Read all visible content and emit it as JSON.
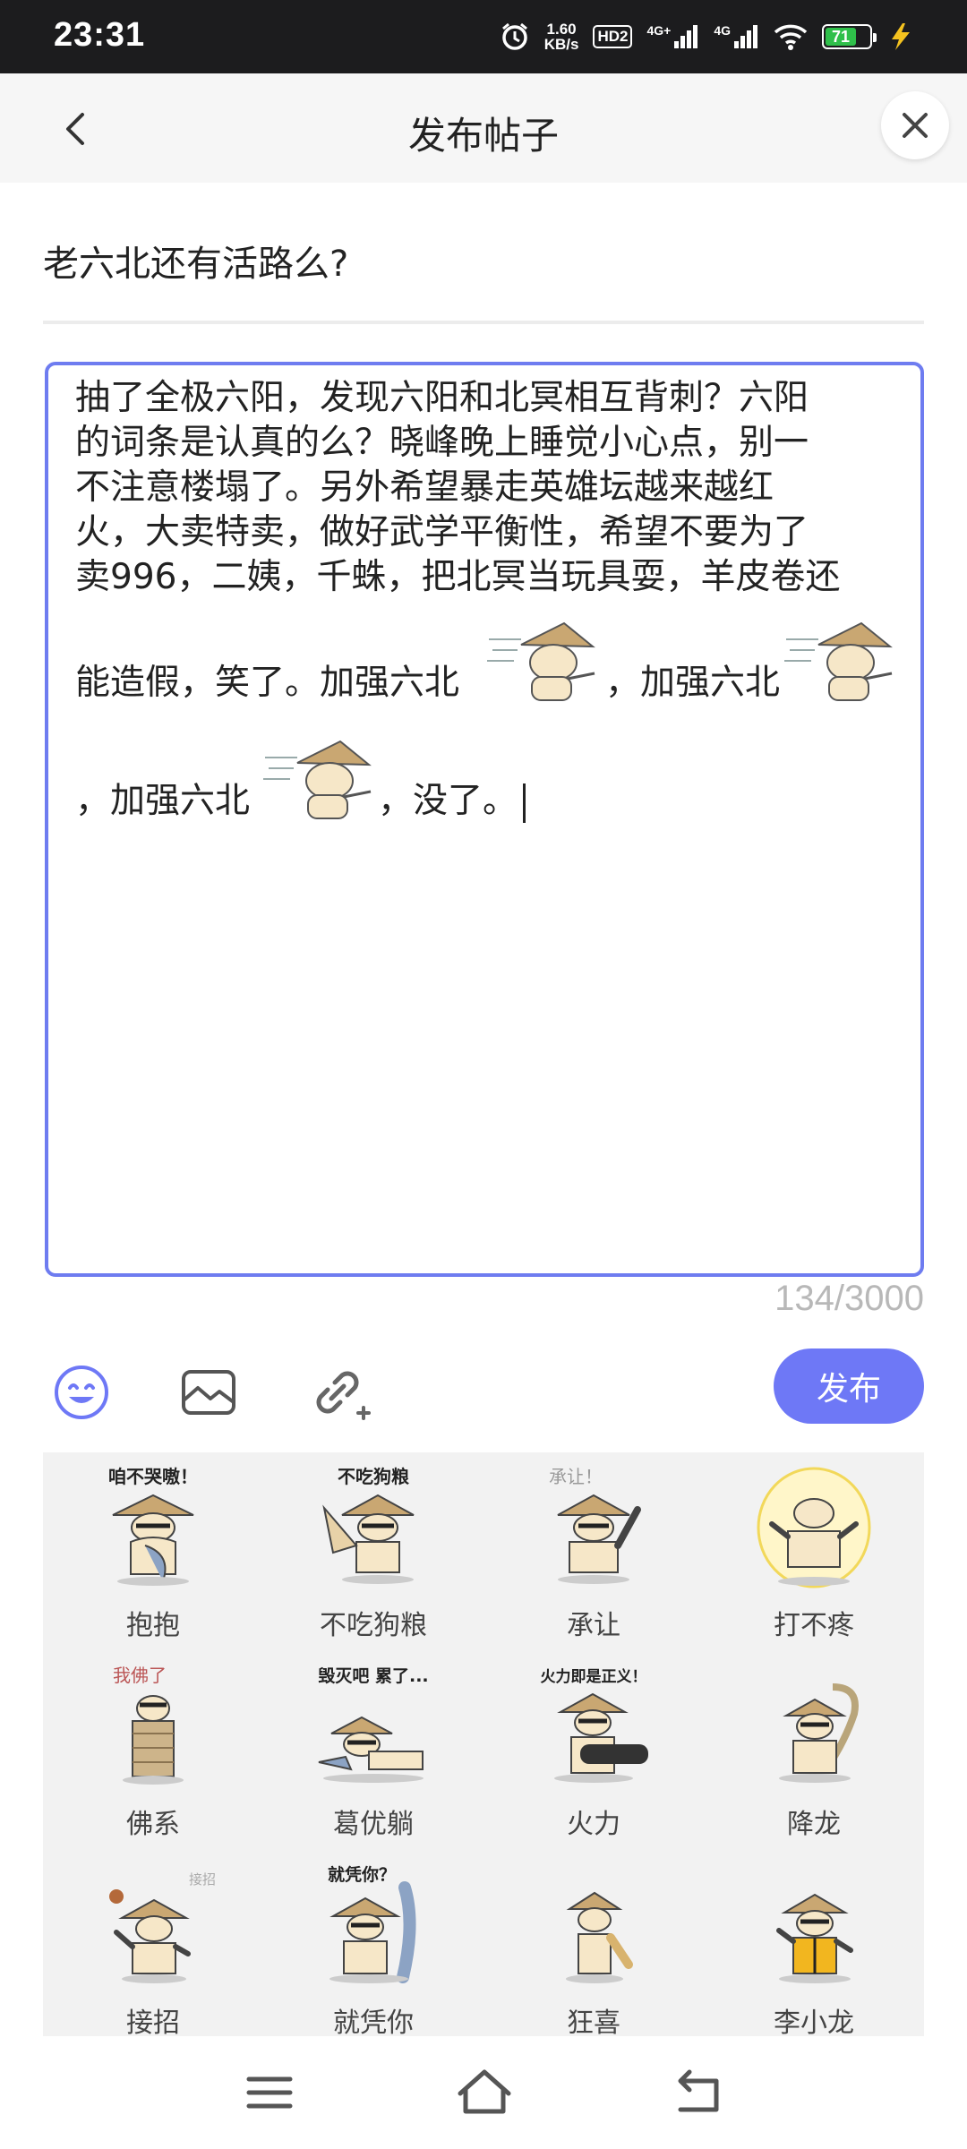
{
  "status_bar": {
    "time": "23:31",
    "net_speed_value": "1.60",
    "net_speed_unit": "KB/s",
    "hd_label": "HD2",
    "signal1_label": "4G+",
    "signal2_label": "4G",
    "battery": "71",
    "icons": [
      "alarm-icon",
      "hd-icon",
      "signal-icon",
      "signal-icon",
      "wifi-icon",
      "battery-icon",
      "charging-icon"
    ]
  },
  "header": {
    "title": "发布帖子",
    "back_icon": "chevron-left-icon",
    "close_icon": "close-icon"
  },
  "post": {
    "title": "老六北还有活路么?",
    "content_lines": [
      "抽了全极六阳，发现六阳和北冥相互背刺？六阳",
      "的词条是认真的么？晓峰晚上睡觉小心点，别一",
      "不注意楼塌了。另外希望暴走英雄坛越来越红",
      "火，大卖特卖，做好武学平衡性，希望不要为了",
      "卖996，二姨，千蛛，把北冥当玩具耍，羊皮卷还"
    ],
    "sticker_line_1_a": "能造假，笑了。加强六北",
    "sticker_line_1_b": "，加强六北",
    "sticker_line_2_a": "，加强六北",
    "sticker_line_2_b": "，没了。",
    "char_count": "134/3000"
  },
  "toolbar": {
    "emoji_icon": "emoji-icon",
    "image_icon": "image-icon",
    "link_icon": "link-add-icon",
    "publish_label": "发布"
  },
  "stickers": [
    {
      "label": "抱抱",
      "caption": "咱不哭嗷！"
    },
    {
      "label": "不吃狗粮",
      "caption": "不吃狗粮"
    },
    {
      "label": "承让",
      "caption": "承让！"
    },
    {
      "label": "打不疼",
      "caption": ""
    },
    {
      "label": "佛系",
      "caption": "我佛了"
    },
    {
      "label": "葛优躺",
      "caption": "毁灭吧 累了..."
    },
    {
      "label": "火力",
      "caption": "火力即是正义！"
    },
    {
      "label": "降龙",
      "caption": ""
    },
    {
      "label": "接招",
      "caption": "接招"
    },
    {
      "label": "就凭你",
      "caption": "就凭你？"
    },
    {
      "label": "狂喜",
      "caption": ""
    },
    {
      "label": "李小龙",
      "caption": ""
    }
  ],
  "nav": {
    "menu_icon": "menu-icon",
    "home_icon": "home-icon",
    "back_icon": "back-icon"
  }
}
